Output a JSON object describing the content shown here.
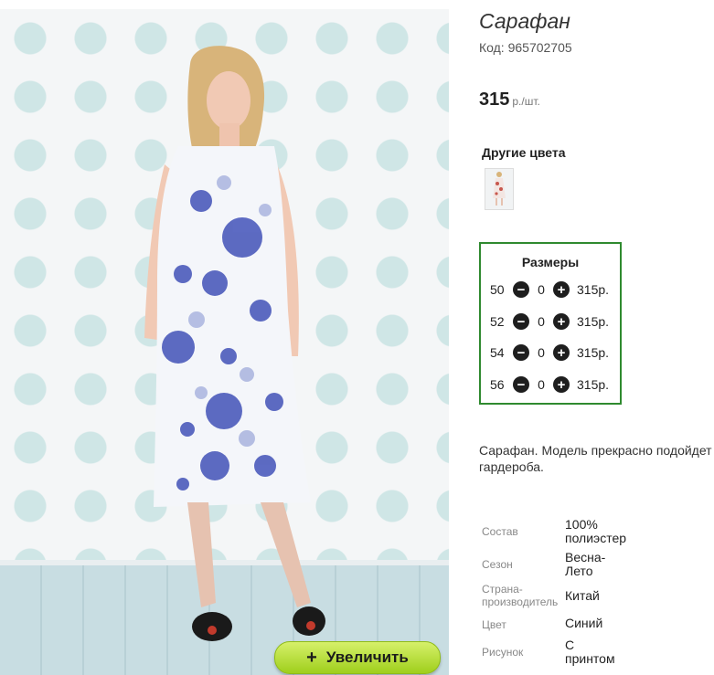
{
  "product": {
    "title": "Сарафан",
    "code": "Код: 965702705",
    "price": "315",
    "price_unit": "р./шт.",
    "zoom_button": "Увеличить",
    "zoom_plus": "+"
  },
  "colors": {
    "title": "Другие цвета"
  },
  "sizes": {
    "title": "Размеры",
    "minus_icon": "minus-circle-icon",
    "plus_icon": "plus-circle-icon",
    "rows": [
      {
        "size": "50",
        "qty": "0",
        "price": "315р."
      },
      {
        "size": "52",
        "qty": "0",
        "price": "315р."
      },
      {
        "size": "54",
        "qty": "0",
        "price": "315р."
      },
      {
        "size": "56",
        "qty": "0",
        "price": "315р."
      }
    ]
  },
  "description": {
    "line1": "Сарафан. Модель прекрасно подойдет",
    "line2": "гардероба."
  },
  "properties": [
    {
      "key": "Состав",
      "value1": "100%",
      "value2": "полиэстер"
    },
    {
      "key": "Сезон",
      "value1": "Весна-",
      "value2": "Лето"
    },
    {
      "key": "Страна-",
      "key2": "производитель",
      "value1": "Китай",
      "value2": ""
    },
    {
      "key": "Цвет",
      "value1": "Синий",
      "value2": ""
    },
    {
      "key": "Рисунок",
      "value1": "С",
      "value2": "принтом"
    }
  ],
  "accent_colors": {
    "sizes_border": "#2f8a2f",
    "zoom_button": "#a8d426"
  }
}
